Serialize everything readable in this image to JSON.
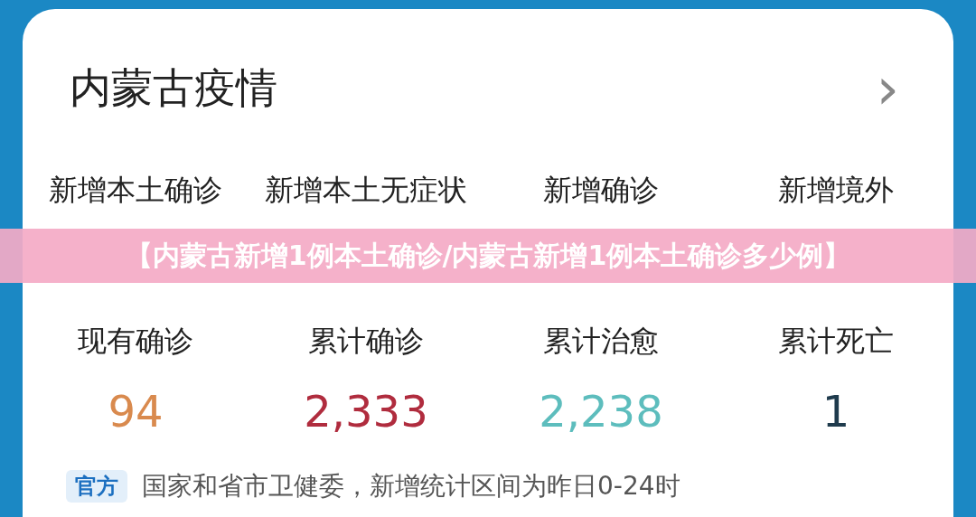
{
  "card": {
    "title": "内蒙古疫情",
    "chevron": "›"
  },
  "new_stats": [
    {
      "label": "新增本土确诊"
    },
    {
      "label": "新增本土无症状"
    },
    {
      "label": "新增确诊"
    },
    {
      "label": "新增境外"
    }
  ],
  "banner": {
    "text": "【内蒙古新增1例本土确诊/内蒙古新增1例本土确诊多少例】"
  },
  "totals": [
    {
      "label": "现有确诊",
      "value": "94",
      "color": "#d98a4e"
    },
    {
      "label": "累计确诊",
      "value": "2,333",
      "color": "#b02c3e"
    },
    {
      "label": "累计治愈",
      "value": "2,238",
      "color": "#5dbdbd"
    },
    {
      "label": "累计死亡",
      "value": "1",
      "color": "#1f3b4d"
    }
  ],
  "footer": {
    "badge": "官方",
    "text": "国家和省市卫健委，新增统计区间为昨日0-24时"
  }
}
